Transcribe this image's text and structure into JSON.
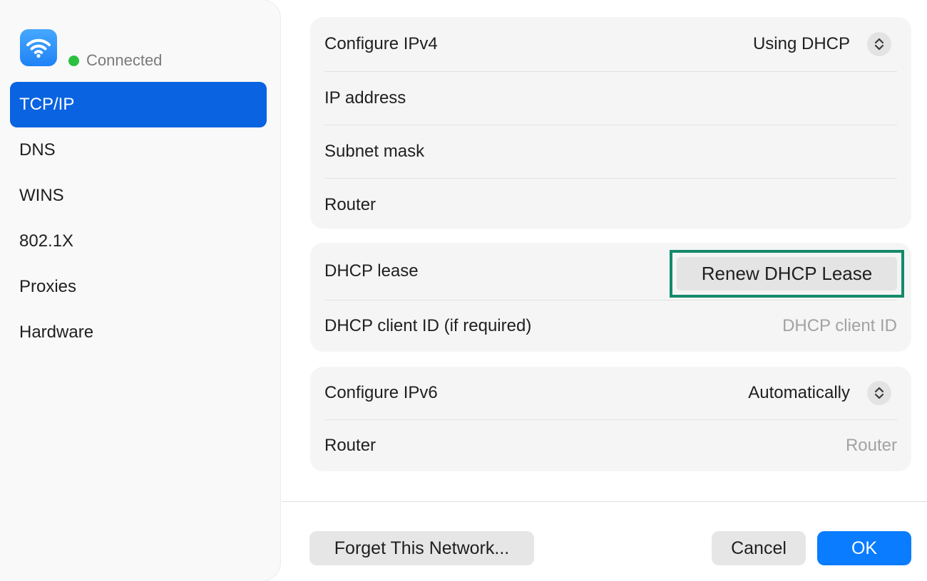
{
  "sidebar": {
    "network_icon": "wifi-icon",
    "status": "Connected",
    "status_color": "#2ac140",
    "items": [
      {
        "label": "TCP/IP",
        "active": true
      },
      {
        "label": "DNS"
      },
      {
        "label": "WINS"
      },
      {
        "label": "802.1X"
      },
      {
        "label": "Proxies"
      },
      {
        "label": "Hardware"
      }
    ]
  },
  "ipv4": {
    "configure_label": "Configure IPv4",
    "configure_value": "Using DHCP",
    "ip_address_label": "IP address",
    "subnet_mask_label": "Subnet mask",
    "router_label": "Router"
  },
  "dhcp": {
    "lease_label": "DHCP lease",
    "renew_button": "Renew DHCP Lease",
    "client_id_label": "DHCP client ID (if required)",
    "client_id_placeholder": "DHCP client ID"
  },
  "ipv6": {
    "configure_label": "Configure IPv6",
    "configure_value": "Automatically",
    "router_label": "Router",
    "router_placeholder": "Router"
  },
  "footer": {
    "forget_button": "Forget This Network...",
    "cancel_button": "Cancel",
    "ok_button": "OK"
  },
  "colors": {
    "accent": "#0a63e0",
    "ok_button": "#0a7cff",
    "highlight_border": "#158a6a"
  }
}
